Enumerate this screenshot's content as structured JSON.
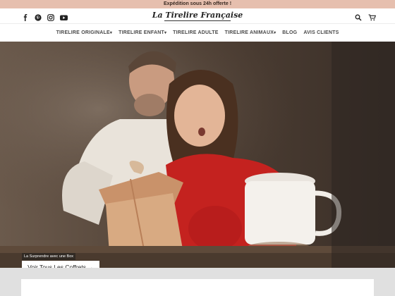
{
  "announcement": "Expédition sous 24h offerte !",
  "brand": {
    "name": "La Tirelire Française"
  },
  "social_icons": [
    "facebook-icon",
    "pinterest-icon",
    "instagram-icon",
    "youtube-icon"
  ],
  "header_icons": [
    "search-icon",
    "cart-icon"
  ],
  "nav": {
    "items": [
      {
        "label": "TIRELIRE ORIGINALE",
        "dropdown": true
      },
      {
        "label": "TIRELIRE ENFANT",
        "dropdown": true
      },
      {
        "label": "TIRELIRE ADULTE",
        "dropdown": false
      },
      {
        "label": "TIRELIRE ANIMAUX",
        "dropdown": true
      },
      {
        "label": "BLOG",
        "dropdown": false
      },
      {
        "label": "AVIS CLIENTS",
        "dropdown": false
      }
    ],
    "caret": "▾"
  },
  "hero": {
    "subtitle": "La Surprendre avec une Box",
    "button_label": "Voir Tous Les Coffrets →"
  },
  "colors": {
    "announcement_bg": "#e6bfae",
    "hero_bg": "#3a3029",
    "section_bg": "#e0e0e0"
  }
}
